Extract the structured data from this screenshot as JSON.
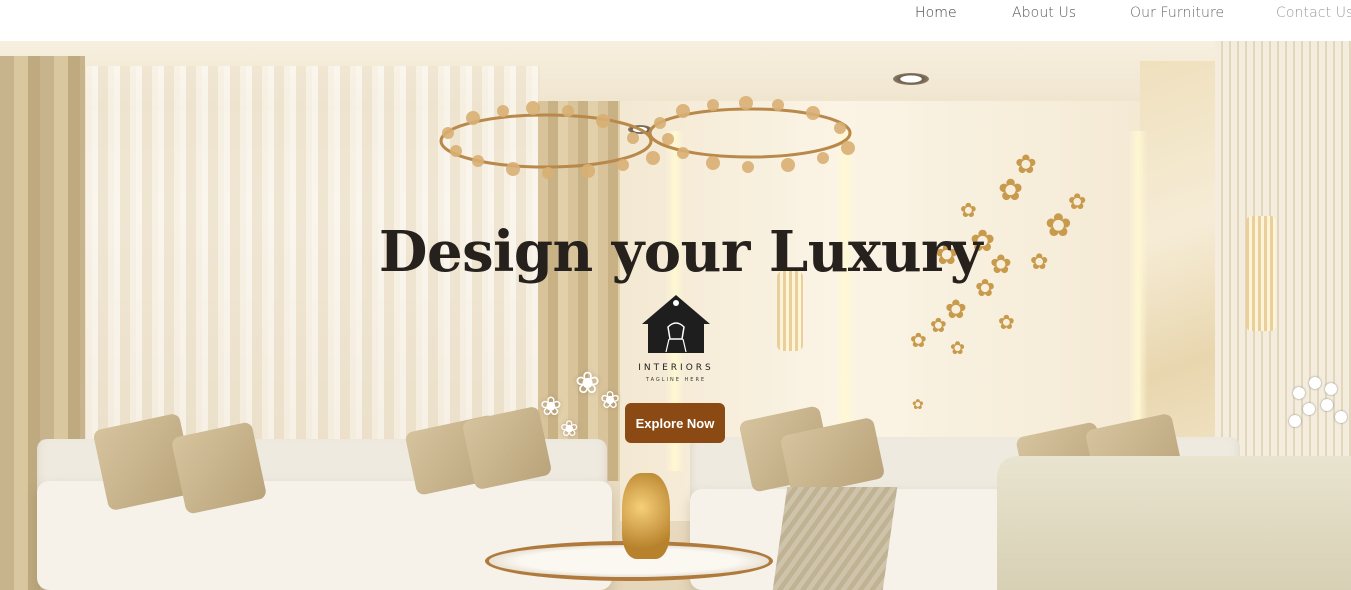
{
  "nav": {
    "items": [
      {
        "label": "Home"
      },
      {
        "label": "About Us"
      },
      {
        "label": "Our Furniture"
      },
      {
        "label": "Contact Us"
      }
    ]
  },
  "hero": {
    "title": "Design your Luxury",
    "logo": {
      "name": "INTERIORS",
      "tagline": "TAGLINE HERE",
      "icon": "house-chair-icon"
    },
    "cta_label": "Explore Now",
    "colors": {
      "cta_background": "#8b4a13",
      "cta_text": "#ffffff",
      "title_text": "#26211d"
    }
  }
}
